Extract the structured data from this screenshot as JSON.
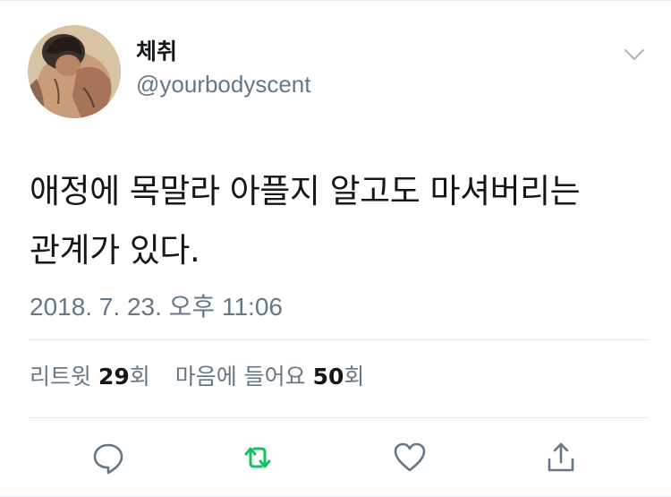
{
  "author": {
    "display_name": "체취",
    "handle": "@yourbodyscent",
    "avatar_icon": "painting-avatar"
  },
  "tweet": {
    "line1": "애정에 목말라 아플지 알고도 마셔버리는",
    "line2": "관계가 있다.",
    "timestamp": "2018. 7. 23. 오후 11:06"
  },
  "stats": {
    "retweets_label": "리트윗",
    "retweets_count": "29",
    "retweets_unit": "회",
    "likes_label": "마음에 들어요",
    "likes_count": "50",
    "likes_unit": "회"
  },
  "actions": {
    "reply_icon": "reply-icon",
    "retweet_icon": "retweet-icon",
    "like_icon": "heart-icon",
    "share_icon": "share-icon"
  },
  "colors": {
    "text_primary": "#14171a",
    "text_secondary": "#657786",
    "retweet_active": "#17bf63",
    "divider": "#e1e8ed"
  }
}
